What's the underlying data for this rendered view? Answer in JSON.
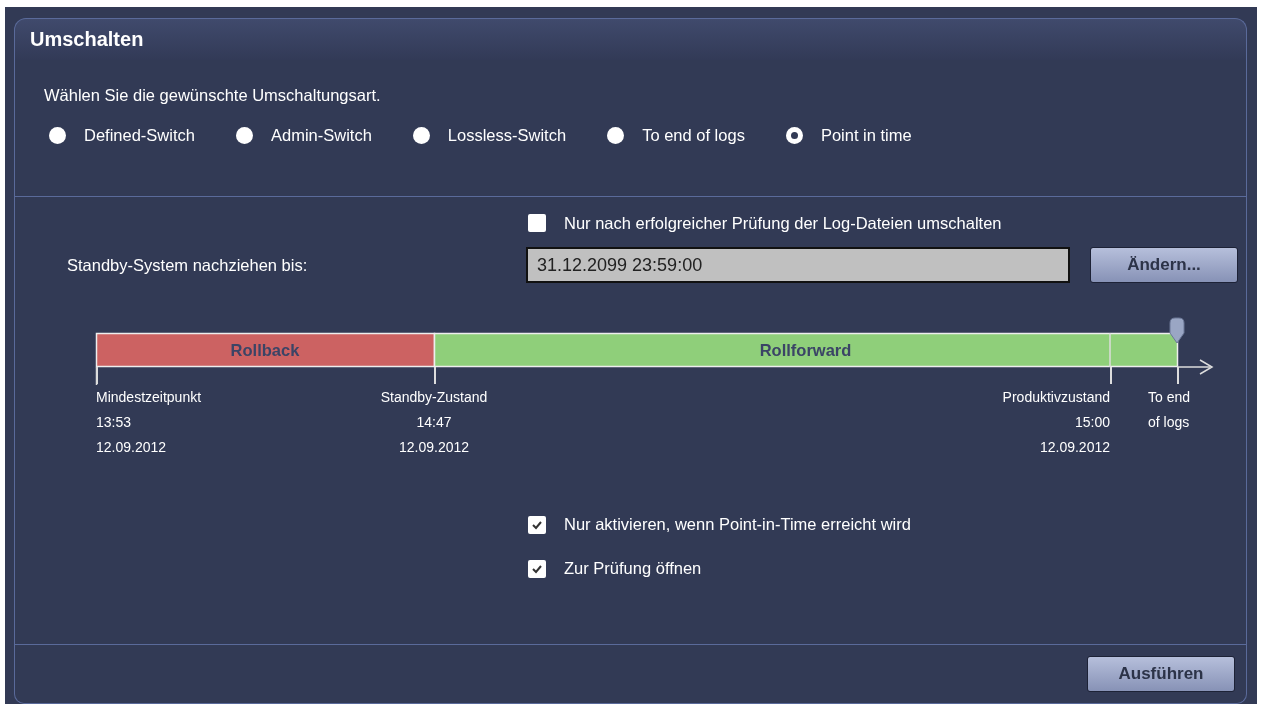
{
  "window": {
    "title": "Umschalten"
  },
  "prompt": "Wählen Sie die gewünschte Umschaltungsart.",
  "switch_types": [
    {
      "label": "Defined-Switch",
      "selected": false
    },
    {
      "label": "Admin-Switch",
      "selected": false
    },
    {
      "label": "Lossless-Switch",
      "selected": false
    },
    {
      "label": "To end of logs",
      "selected": false
    },
    {
      "label": "Point in time",
      "selected": true
    }
  ],
  "verify_logs": {
    "label": "Nur nach erfolgreicher Prüfung der Log-Dateien umschalten",
    "checked": false
  },
  "standby_until": {
    "label": "Standby-System nachziehen bis:",
    "value": "31.12.2099 23:59:00",
    "button": "Ändern..."
  },
  "timeline": {
    "segments": [
      {
        "kind": "rollback",
        "label": "Rollback"
      },
      {
        "kind": "rollforward",
        "label": "Rollforward"
      }
    ],
    "markers": [
      {
        "lines": [
          "Mindestzeitpunkt",
          "13:53",
          "12.09.2012"
        ]
      },
      {
        "lines": [
          "Standby-Zustand",
          "14:47",
          "12.09.2012"
        ]
      },
      {
        "lines": [
          "Produktivzustand",
          "15:00",
          "12.09.2012"
        ]
      },
      {
        "lines": [
          "To end",
          "of logs"
        ]
      }
    ]
  },
  "options": [
    {
      "label": "Nur aktivieren, wenn Point-in-Time erreicht wird",
      "checked": true
    },
    {
      "label": "Zur Prüfung öffnen",
      "checked": true
    }
  ],
  "buttons": [
    "Ausführen"
  ]
}
